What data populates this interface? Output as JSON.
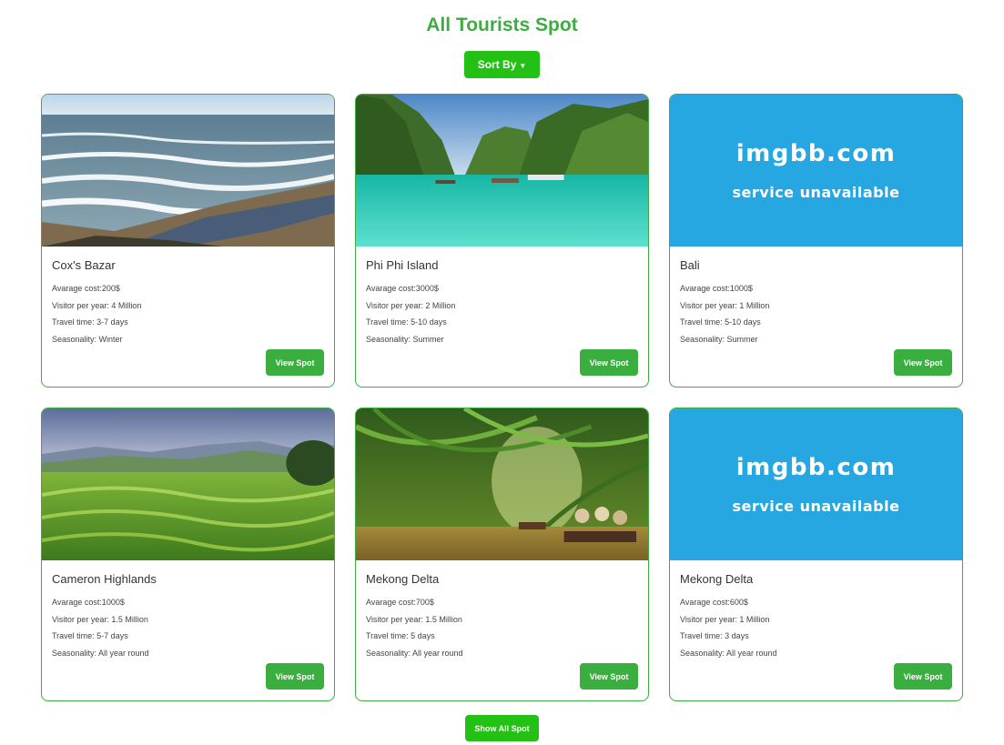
{
  "header": {
    "title": "All Tourists Spot"
  },
  "sort": {
    "label": "Sort By",
    "chevron": "▼"
  },
  "colors": {
    "accent": "#3aae3e",
    "button": "#22c114",
    "imgbb_bg": "#27a7e1"
  },
  "cards": [
    {
      "name": "Cox's Bazar",
      "cost": "Avarage cost:200$",
      "visitors": "Visitor per year: 4 Million",
      "travel": "Travel time: 3-7 days",
      "season": "Seasonality: Winter",
      "button": "View Spot",
      "image": "beach-photo"
    },
    {
      "name": "Phi Phi Island",
      "cost": "Avarage cost:3000$",
      "visitors": "Visitor per year: 2 Million",
      "travel": "Travel time: 5-10 days",
      "season": "Seasonality: Summer",
      "button": "View Spot",
      "image": "island-lagoon-photo"
    },
    {
      "name": "Bali",
      "cost": "Avarage cost:1000$",
      "visitors": "Visitor per year: 1 Million",
      "travel": "Travel time: 5-10 days",
      "season": "Seasonality: Summer",
      "button": "View Spot",
      "image": "imgbb-placeholder",
      "img_line1": "imgbb.com",
      "img_line2": "service unavailable"
    },
    {
      "name": "Cameron Highlands",
      "cost": "Avarage cost:1000$",
      "visitors": "Visitor per year: 1.5 Million",
      "travel": "Travel time: 5-7 days",
      "season": "Seasonality: All year round",
      "button": "View Spot",
      "image": "green-hills-photo"
    },
    {
      "name": "Mekong Delta",
      "cost": "Avarage cost:700$",
      "visitors": "Visitor per year: 1.5 Million",
      "travel": "Travel time: 5 days",
      "season": "Seasonality: All year round",
      "button": "View Spot",
      "image": "river-boats-photo"
    },
    {
      "name": "Mekong Delta",
      "cost": "Avarage cost:600$",
      "visitors": "Visitor per year: 1 Million",
      "travel": "Travel time: 3 days",
      "season": "Seasonality: All year round",
      "button": "View Spot",
      "image": "imgbb-placeholder",
      "img_line1": "imgbb.com",
      "img_line2": "service unavailable"
    }
  ],
  "footer": {
    "show_all_label": "Show All Spot"
  }
}
